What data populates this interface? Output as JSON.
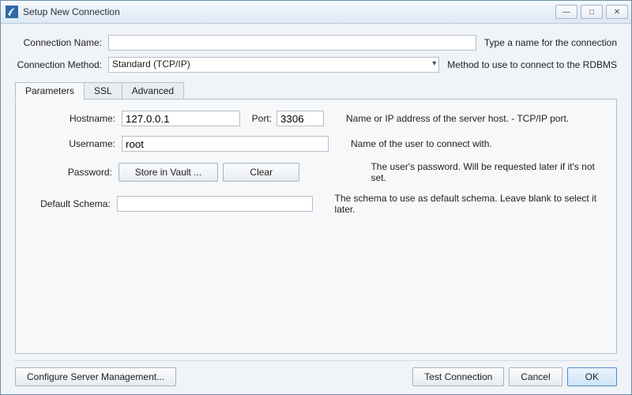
{
  "window": {
    "title": "Setup New Connection"
  },
  "winButtons": {
    "min": "—",
    "max": "□",
    "close": "✕"
  },
  "labels": {
    "connName": "Connection Name:",
    "connMethod": "Connection Method:",
    "hostname": "Hostname:",
    "port": "Port:",
    "username": "Username:",
    "password": "Password:",
    "defaultSchema": "Default Schema:"
  },
  "values": {
    "connName": "",
    "connMethod": "Standard (TCP/IP)",
    "hostname": "127.0.0.1",
    "port": "3306",
    "username": "root",
    "defaultSchema": ""
  },
  "hints": {
    "connName": "Type a name for the connection",
    "connMethod": "Method to use to connect to the RDBMS",
    "hostname": "Name or IP address of the server host. - TCP/IP port.",
    "username": "Name of the user to connect with.",
    "password": "The user's password. Will be requested later if it's not set.",
    "defaultSchema": "The schema to use as default schema. Leave blank to select it later."
  },
  "tabs": {
    "parameters": "Parameters",
    "ssl": "SSL",
    "advanced": "Advanced"
  },
  "buttons": {
    "storeVault": "Store in Vault ...",
    "clear": "Clear",
    "configure": "Configure Server Management...",
    "test": "Test Connection",
    "cancel": "Cancel",
    "ok": "OK"
  }
}
